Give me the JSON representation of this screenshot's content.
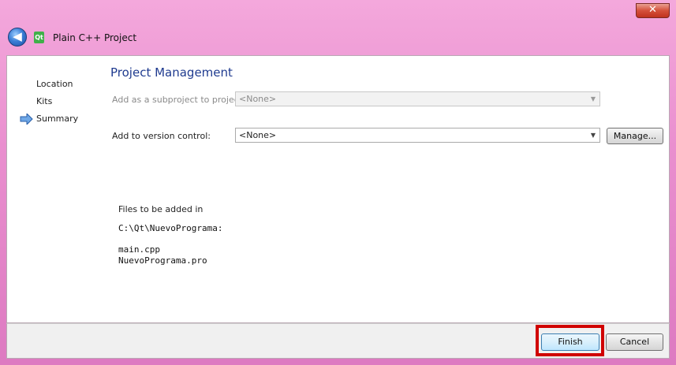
{
  "window": {
    "title": "Plain C++ Project",
    "close_glyph": "✕",
    "back_glyph": "◀",
    "app_icon_text": "Qt"
  },
  "sidebar": {
    "items": [
      {
        "label": "Location"
      },
      {
        "label": "Kits"
      },
      {
        "label": "Summary",
        "current": true
      }
    ]
  },
  "main": {
    "heading": "Project Management",
    "subproject_label": "Add as a subproject to project:",
    "subproject_value": "<None>",
    "vcs_label": "Add to version control:",
    "vcs_value": "<None>",
    "manage_label": "Manage...",
    "files_title": "Files to be added in",
    "files_path": "C:\\Qt\\NuevoPrograma:",
    "files": [
      "main.cpp",
      "NuevoPrograma.pro"
    ]
  },
  "footer": {
    "finish_label": "Finish",
    "cancel_label": "Cancel"
  },
  "colors": {
    "heading": "#1f3b8f",
    "highlight": "#d00000",
    "frame": "#e98fcf"
  },
  "icons": {
    "back": "back-arrow-icon",
    "app": "qt-creator-icon",
    "current_step": "current-step-arrow-icon",
    "dropdown": "chevron-down-icon",
    "close": "close-icon"
  }
}
